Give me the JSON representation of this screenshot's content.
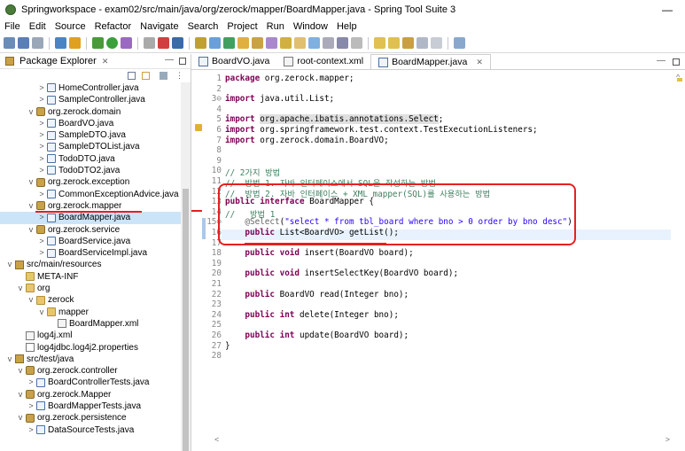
{
  "window": {
    "title": "Springworkspace - exam02/src/main/java/org/zerock/mapper/BoardMapper.java - Spring Tool Suite 3",
    "minimize": "—"
  },
  "menu": [
    "File",
    "Edit",
    "Source",
    "Refactor",
    "Navigate",
    "Search",
    "Project",
    "Run",
    "Window",
    "Help"
  ],
  "package_explorer": {
    "label": "Package Explorer",
    "close": "✕",
    "tree": [
      {
        "text": "HomeController.java",
        "indent": 3,
        "arrow": ">",
        "icon": "java"
      },
      {
        "text": "SampleController.java",
        "indent": 3,
        "arrow": ">",
        "icon": "java"
      },
      {
        "text": "org.zerock.domain",
        "indent": 2,
        "arrow": "v",
        "icon": "pkg"
      },
      {
        "text": "BoardVO.java",
        "indent": 3,
        "arrow": ">",
        "icon": "java"
      },
      {
        "text": "SampleDTO.java",
        "indent": 3,
        "arrow": ">",
        "icon": "java"
      },
      {
        "text": "SampleDTOList.java",
        "indent": 3,
        "arrow": ">",
        "icon": "java"
      },
      {
        "text": "TodoDTO.java",
        "indent": 3,
        "arrow": ">",
        "icon": "java"
      },
      {
        "text": "TodoDTO2.java",
        "indent": 3,
        "arrow": ">",
        "icon": "java"
      },
      {
        "text": "org.zerock.exception",
        "indent": 2,
        "arrow": "v",
        "icon": "pkg"
      },
      {
        "text": "CommonExceptionAdvice.java",
        "indent": 3,
        "arrow": ">",
        "icon": "java"
      },
      {
        "text": "org.zerock.mapper",
        "indent": 2,
        "arrow": "v",
        "icon": "pkg"
      },
      {
        "text": "BoardMapper.java",
        "indent": 3,
        "arrow": ">",
        "icon": "java",
        "selected": true
      },
      {
        "text": "org.zerock.service",
        "indent": 2,
        "arrow": "v",
        "icon": "pkg"
      },
      {
        "text": "BoardService.java",
        "indent": 3,
        "arrow": ">",
        "icon": "java"
      },
      {
        "text": "BoardServiceImpl.java",
        "indent": 3,
        "arrow": ">",
        "icon": "java"
      },
      {
        "text": "src/main/resources",
        "indent": 0,
        "arrow": "v",
        "icon": "srcfolder"
      },
      {
        "text": "META-INF",
        "indent": 1,
        "arrow": "",
        "icon": "folder"
      },
      {
        "text": "org",
        "indent": 1,
        "arrow": "v",
        "icon": "folder"
      },
      {
        "text": "zerock",
        "indent": 2,
        "arrow": "v",
        "icon": "folder"
      },
      {
        "text": "mapper",
        "indent": 3,
        "arrow": "v",
        "icon": "folder"
      },
      {
        "text": "BoardMapper.xml",
        "indent": 4,
        "arrow": "",
        "icon": "xml"
      },
      {
        "text": "log4j.xml",
        "indent": 1,
        "arrow": "",
        "icon": "xml"
      },
      {
        "text": "log4jdbc.log4j2.properties",
        "indent": 1,
        "arrow": "",
        "icon": "props"
      },
      {
        "text": "src/test/java",
        "indent": 0,
        "arrow": "v",
        "icon": "srcfolder"
      },
      {
        "text": "org.zerock.controller",
        "indent": 1,
        "arrow": "v",
        "icon": "pkg"
      },
      {
        "text": "BoardControllerTests.java",
        "indent": 2,
        "arrow": ">",
        "icon": "java"
      },
      {
        "text": "org.zerock.Mapper",
        "indent": 1,
        "arrow": "v",
        "icon": "pkg"
      },
      {
        "text": "BoardMapperTests.java",
        "indent": 2,
        "arrow": ">",
        "icon": "java"
      },
      {
        "text": "org.zerock.persistence",
        "indent": 1,
        "arrow": "v",
        "icon": "pkg"
      },
      {
        "text": "DataSourceTests.java",
        "indent": 2,
        "arrow": ">",
        "icon": "java"
      }
    ]
  },
  "tabs": [
    {
      "label": "BoardVO.java",
      "icon": "java",
      "active": false
    },
    {
      "label": "root-context.xml",
      "icon": "xml",
      "active": false
    },
    {
      "label": "BoardMapper.java",
      "icon": "java",
      "active": true,
      "close": "✕"
    }
  ],
  "code": [
    {
      "n": "1",
      "parts": [
        [
          "kw",
          "package"
        ],
        [
          "t",
          " org.zerock.mapper;"
        ]
      ]
    },
    {
      "n": "2",
      "parts": []
    },
    {
      "n": "3⊖",
      "parts": [
        [
          "kw",
          "import"
        ],
        [
          "t",
          " java.util.List;"
        ]
      ]
    },
    {
      "n": "4",
      "parts": []
    },
    {
      "n": "5",
      "parts": [
        [
          "kw",
          "import"
        ],
        [
          "t",
          " "
        ],
        [
          "hl",
          "org.apache.ibatis.annotations.Select"
        ],
        [
          "t",
          ";"
        ]
      ]
    },
    {
      "n": "6",
      "parts": [
        [
          "kw",
          "import"
        ],
        [
          "t",
          " org.springframework.test.context.TestExecutionListeners;"
        ]
      ]
    },
    {
      "n": "7",
      "parts": [
        [
          "kw",
          "import"
        ],
        [
          "t",
          " org.zerock.domain.BoardVO;"
        ]
      ]
    },
    {
      "n": "8",
      "parts": []
    },
    {
      "n": "9",
      "parts": []
    },
    {
      "n": "10",
      "parts": [
        [
          "cmt",
          "// 2가지 방법"
        ]
      ]
    },
    {
      "n": "11",
      "parts": [
        [
          "cmt",
          "//  방법 1. 자바 인터페이스에서 SQL을 작성하는 방법"
        ]
      ]
    },
    {
      "n": "12",
      "parts": [
        [
          "cmt",
          "//  방법 2. 자바 인터페이스 + XML mapper(SQL)를 사용하는 방법"
        ]
      ]
    },
    {
      "n": "13",
      "parts": [
        [
          "kw",
          "public"
        ],
        [
          "t",
          " "
        ],
        [
          "kw",
          "interface"
        ],
        [
          "t",
          " BoardMapper {"
        ]
      ]
    },
    {
      "n": "14",
      "parts": [
        [
          "cmt",
          "//   방법 1"
        ]
      ]
    },
    {
      "n": "15⊖",
      "parts": [
        [
          "t",
          "    "
        ],
        [
          "ann",
          "@Select"
        ],
        [
          "t",
          "("
        ],
        [
          "str",
          "\"select * from tbl_board where bno > 0 order by bno desc\""
        ],
        [
          "t",
          ")"
        ]
      ],
      "current": true
    },
    {
      "n": "16",
      "parts": [
        [
          "t",
          "    "
        ],
        [
          "kw",
          "public"
        ],
        [
          "t",
          " List<BoardVO> getList();"
        ]
      ]
    },
    {
      "n": "17",
      "parts": []
    },
    {
      "n": "18",
      "parts": [
        [
          "t",
          "    "
        ],
        [
          "kw",
          "public"
        ],
        [
          "t",
          " "
        ],
        [
          "kw",
          "void"
        ],
        [
          "t",
          " insert(BoardVO board);"
        ]
      ]
    },
    {
      "n": "19",
      "parts": []
    },
    {
      "n": "20",
      "parts": [
        [
          "t",
          "    "
        ],
        [
          "kw",
          "public"
        ],
        [
          "t",
          " "
        ],
        [
          "kw",
          "void"
        ],
        [
          "t",
          " insertSelectKey(BoardVO board);"
        ]
      ]
    },
    {
      "n": "21",
      "parts": []
    },
    {
      "n": "22",
      "parts": [
        [
          "t",
          "    "
        ],
        [
          "kw",
          "public"
        ],
        [
          "t",
          " BoardVO read(Integer bno);"
        ]
      ]
    },
    {
      "n": "23",
      "parts": []
    },
    {
      "n": "24",
      "parts": [
        [
          "t",
          "    "
        ],
        [
          "kw",
          "public"
        ],
        [
          "t",
          " "
        ],
        [
          "kw",
          "int"
        ],
        [
          "t",
          " delete(Integer bno);"
        ]
      ]
    },
    {
      "n": "25",
      "parts": []
    },
    {
      "n": "26",
      "parts": [
        [
          "t",
          "    "
        ],
        [
          "kw",
          "public"
        ],
        [
          "t",
          " "
        ],
        [
          "kw",
          "int"
        ],
        [
          "t",
          " update(BoardVO board);"
        ]
      ]
    },
    {
      "n": "27",
      "parts": [
        [
          "t",
          "}"
        ]
      ]
    },
    {
      "n": "28",
      "parts": []
    }
  ],
  "colors": {
    "keyword": "#7f0055",
    "string": "#2a00ff",
    "comment": "#3f7f5f",
    "annotation": "#646464",
    "selection": "#cce4f7",
    "current_line": "#e8f2fe",
    "red_mark": "#e52020"
  },
  "icons": [
    "app-icon",
    "save-icon",
    "run-icon",
    "debug-icon",
    "search-icon",
    "minimize-icon",
    "maximize-icon",
    "close-icon",
    "collapse-all-icon",
    "link-editor-icon",
    "view-menu-icon",
    "java-file-icon",
    "package-icon",
    "folder-icon",
    "xml-file-icon"
  ]
}
